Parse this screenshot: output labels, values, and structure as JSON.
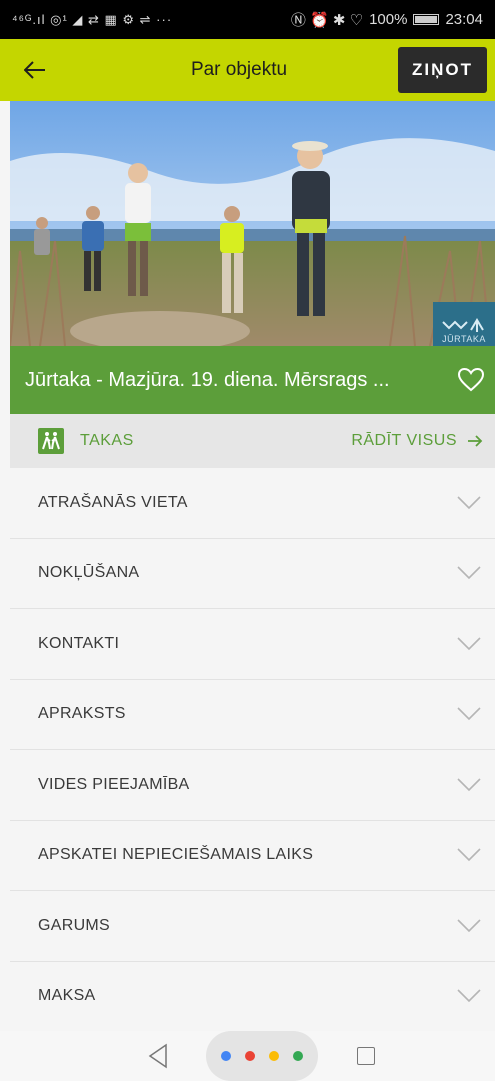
{
  "status_bar": {
    "left_icons": "⁴⁶ᴳ.ıl ◎¹ ◢ ⇄ ▦ ⚙ ⇌ ···",
    "right_icons": "Ⓝ ⏰ ✱ ♡",
    "battery": "100%",
    "time": "23:04"
  },
  "app_bar": {
    "title": "Par objektu",
    "report_label": "ZIŅOT",
    "back_icon": "arrow-left-icon"
  },
  "hero": {
    "logo_text": "JŪRTAKA"
  },
  "object": {
    "title": "Jūrtaka - Mazjūra. 19. diena. Mērsrags ...",
    "favorite_icon": "heart-outline-icon"
  },
  "category": {
    "label": "TAKAS",
    "show_all": "RĀDĪT VISUS",
    "icon": "hikers-icon"
  },
  "sections": [
    {
      "label": "ATRAŠANĀS VIETA"
    },
    {
      "label": "NOKĻŪŠANA"
    },
    {
      "label": "KONTAKTI"
    },
    {
      "label": "APRAKSTS"
    },
    {
      "label": "VIDES PIEEJAMĪBA"
    },
    {
      "label": "APSKATEI NEPIECIEŠAMAIS LAIKS"
    },
    {
      "label": "GARUMS"
    },
    {
      "label": "MAKSA"
    }
  ],
  "nav_bar": {
    "dots": [
      "#4285f4",
      "#ea4335",
      "#fbbc05",
      "#34a853"
    ]
  },
  "colors": {
    "accent": "#c4d600",
    "green": "#5c9e3a",
    "report_bg": "#2b2b2b"
  }
}
